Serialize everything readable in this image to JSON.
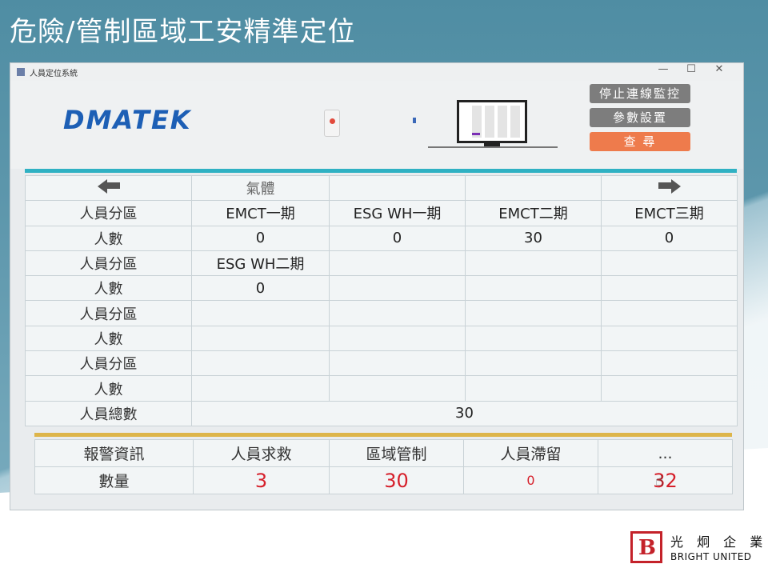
{
  "slide": {
    "title": "危險/管制區域工安精準定位"
  },
  "window": {
    "title": "人員定位系統",
    "controls": [
      "—",
      "☐",
      "✕"
    ]
  },
  "header": {
    "logo": "DMATEK",
    "buttons": {
      "stop": "停止連線監控",
      "params": "參數設置",
      "query": "查 尋"
    }
  },
  "grid": {
    "category": "氣體",
    "rows": [
      [
        "人員分區",
        "EMCT一期",
        "ESG WH一期",
        "EMCT二期",
        "EMCT三期"
      ],
      [
        "人數",
        "0",
        "0",
        "30",
        "0"
      ],
      [
        "人員分區",
        "ESG WH二期",
        "",
        "",
        ""
      ],
      [
        "人數",
        "0",
        "",
        "",
        ""
      ],
      [
        "人員分區",
        "",
        "",
        "",
        ""
      ],
      [
        "人數",
        "",
        "",
        "",
        ""
      ],
      [
        "人員分區",
        "",
        "",
        "",
        ""
      ],
      [
        "人數",
        "",
        "",
        "",
        ""
      ]
    ],
    "total_label": "人員總數",
    "total_value": "30"
  },
  "alarm": {
    "headers": [
      "報警資訊",
      "人員求救",
      "區域管制",
      "人員滯留",
      "..."
    ],
    "label": "數量",
    "values": [
      "3",
      "30",
      "0",
      "32"
    ]
  },
  "brand": {
    "letter": "B",
    "cn": "光 炯 企 業",
    "en": "BRIGHT UNITED"
  },
  "colors": {
    "logo": "#1d5fb5",
    "accent_cyan": "#2fb1c3",
    "accent_gold": "#ddb54a",
    "alarm_red": "#d6202b",
    "query_button": "#ee7b4c"
  }
}
